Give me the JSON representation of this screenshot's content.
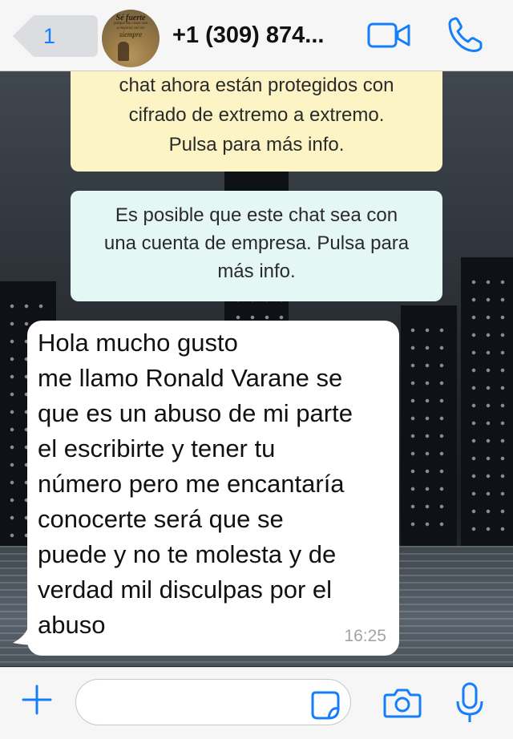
{
  "header": {
    "back_count": "1",
    "contact_title": "+1 (309) 874...",
    "avatar_text": [
      "Sé fuerte",
      "porque las cosas van",
      "a mejorar, tal vez",
      "siempre"
    ]
  },
  "chat": {
    "encryption_notice": [
      "chat ahora están protegidos con",
      "cifrado de extremo a extremo.",
      "Pulsa para más info."
    ],
    "business_notice": [
      "Es posible que este chat sea con",
      "una cuenta de empresa. Pulsa para",
      "más info."
    ],
    "message": {
      "lines": [
        "Hola                  mucho gusto",
        "me llamo Ronald Varane se",
        "que es un abuso de mi parte",
        "el escribirte y tener tu",
        "número pero me encantaría",
        "conocerte será que se",
        "puede y no te molesta y de",
        "verdad mil disculpas por el",
        "abuso"
      ],
      "time": "16:25"
    }
  },
  "input": {
    "value": ""
  },
  "colors": {
    "accent": "#147efb",
    "encryption_bubble": "#fcf4c4",
    "business_bubble": "#e4f7f5",
    "incoming_bubble": "#ffffff"
  },
  "icons": {
    "back": "chevron-left-icon",
    "video": "video-camera-icon",
    "phone": "phone-icon",
    "plus": "plus-icon",
    "sticker": "sticker-icon",
    "camera": "camera-icon",
    "mic": "microphone-icon"
  }
}
